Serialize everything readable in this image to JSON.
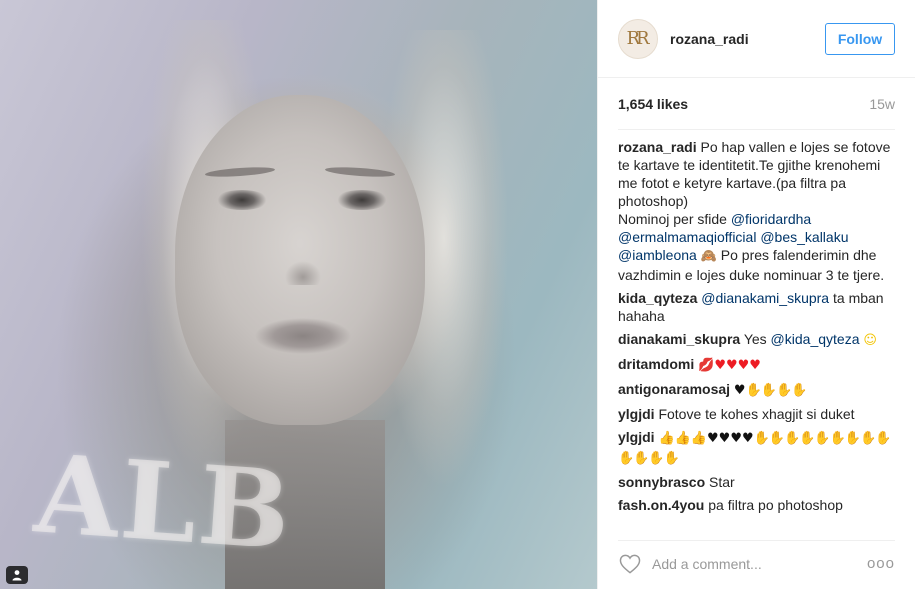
{
  "post": {
    "username": "rozana_radi",
    "avatar_text": "RR",
    "follow_label": "Follow",
    "likes": "1,654 likes",
    "time": "15w",
    "photo_stamp": "ALB"
  },
  "caption": {
    "username": "rozana_radi",
    "text1": "Po hap vallen e lojes se fotove te kartave te identitetit.Te gjithe krenohemi me fotot e ketyre kartave.(pa filtra pa photoshop)",
    "text2": "Nominoj per sfide",
    "mention1": "@fioridardha",
    "mention2": "@ermalmamaqiofficial",
    "mention3": "@bes_kallaku",
    "mention4": "@iambleona",
    "text3": "Po pres falenderimin dhe vazhdimin e lojes duke nominuar 3 te tjere."
  },
  "comments": [
    {
      "username": "kida_qyteza",
      "mention": "@dianakami_skupra",
      "text": "ta mban hahaha"
    },
    {
      "username": "dianakami_skupra",
      "text": "Yes",
      "mention": "@kida_qyteza"
    },
    {
      "username": "dritamdomi"
    },
    {
      "username": "antigonaramosaj"
    },
    {
      "username": "ylgjdi",
      "text": "Fotove te kohes xhagjit si duket"
    },
    {
      "username": "ylgjdi"
    },
    {
      "username": "sonnybrasco",
      "text": "Star"
    },
    {
      "username": "fash.on.4you",
      "text": "pa filtra po photoshop"
    }
  ],
  "add_comment": {
    "placeholder": "Add a comment..."
  },
  "more_label": "ooo",
  "icons": {
    "like": "heart-outline-icon",
    "user_tag": "user-tag-icon",
    "more": "more-options-icon"
  },
  "colors": {
    "accent": "#3897f0",
    "mention": "#003569",
    "muted": "#999999",
    "text": "#262626"
  }
}
